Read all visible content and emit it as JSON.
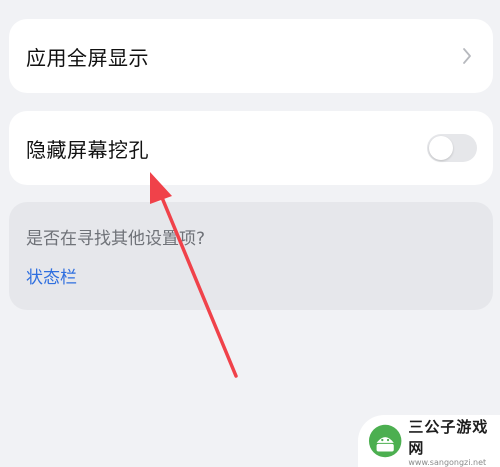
{
  "settings": {
    "fullscreen_label": "应用全屏显示",
    "hide_notch_label": "隐藏屏幕挖孔",
    "hide_notch_enabled": false
  },
  "suggestion": {
    "question": "是否在寻找其他设置项?",
    "link": "状态栏"
  },
  "watermark": {
    "title": "三公子游戏网",
    "url": "www.sangongzi.net"
  },
  "colors": {
    "background": "#f1f2f5",
    "card": "#ffffff",
    "link": "#2f6fdf",
    "arrow": "#f0424a"
  }
}
